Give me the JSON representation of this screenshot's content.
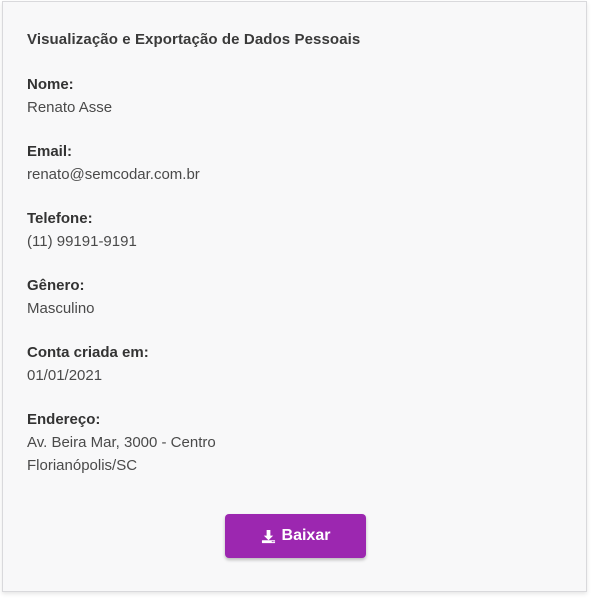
{
  "page": {
    "title": "Visualização e Exportação de Dados Pessoais"
  },
  "fields": {
    "nome": {
      "label": "Nome:",
      "value": "Renato Asse"
    },
    "email": {
      "label": "Email:",
      "value": "renato@semcodar.com.br"
    },
    "telefone": {
      "label": "Telefone:",
      "value": "(11) 99191-9191"
    },
    "genero": {
      "label": "Gênero:",
      "value": "Masculino"
    },
    "conta": {
      "label": "Conta criada em:",
      "value": "01/01/2021"
    },
    "endereco": {
      "label": "Endereço:",
      "line1": "Av. Beira Mar, 3000 - Centro",
      "line2": "Florianópolis/SC"
    }
  },
  "download_button": {
    "label": "Baixar",
    "icon": "download-icon",
    "color": "#9c27b0"
  }
}
